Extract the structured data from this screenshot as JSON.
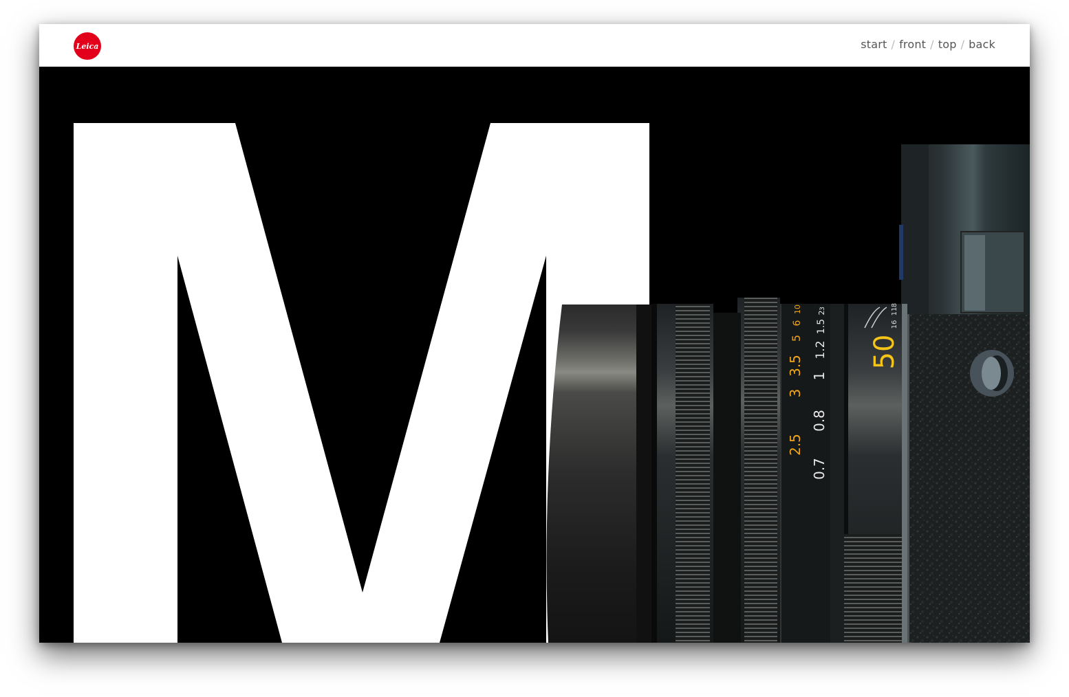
{
  "brand": {
    "logo_text": "Leica",
    "color": "#e2001a"
  },
  "nav": {
    "items": [
      "start",
      "front",
      "top",
      "back"
    ],
    "separator": "/"
  },
  "hero": {
    "letter": "M"
  },
  "lens": {
    "focal_length": "50",
    "aperture_marks": [
      "16",
      "11",
      "8"
    ],
    "distance_scale_feet": [
      "2.5",
      "3",
      "3.5",
      "5",
      "6",
      "10"
    ],
    "distance_scale_meters": [
      "0.7",
      "0.8",
      "1",
      "1.2",
      "1.5",
      "2",
      "3"
    ],
    "scale_colors": {
      "feet": "#f2a51a",
      "meters": "#e8e8e8",
      "focal": "#f5c518"
    }
  }
}
